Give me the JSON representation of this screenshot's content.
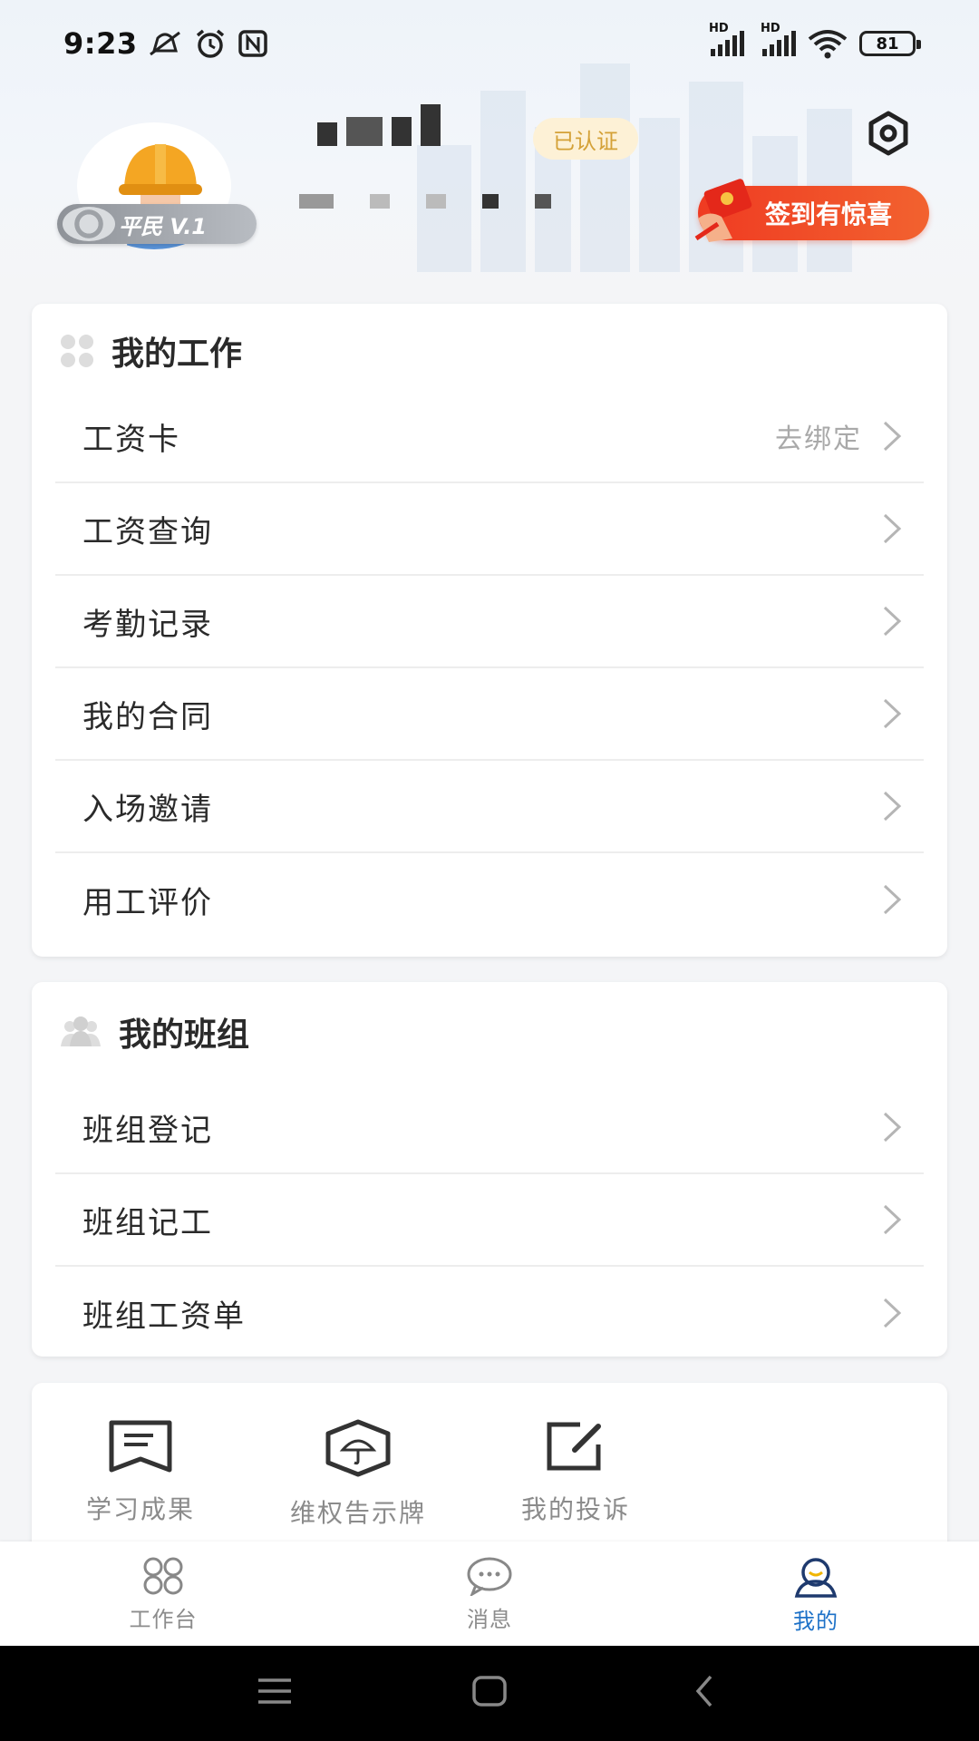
{
  "status_bar": {
    "time": "9:23",
    "battery": "81",
    "signal_label": "HD"
  },
  "profile": {
    "verified_label": "已认证",
    "level_label": "平民 V.1",
    "checkin_label": "签到有惊喜"
  },
  "work_section": {
    "title": "我的工作",
    "items": [
      {
        "label": "工资卡",
        "extra": "去绑定"
      },
      {
        "label": "工资查询"
      },
      {
        "label": "考勤记录"
      },
      {
        "label": "我的合同"
      },
      {
        "label": "入场邀请"
      },
      {
        "label": "用工评价"
      }
    ]
  },
  "team_section": {
    "title": "我的班组",
    "items": [
      {
        "label": "班组登记"
      },
      {
        "label": "班组记工"
      },
      {
        "label": "班组工资单"
      }
    ]
  },
  "quick_actions": [
    {
      "label": "学习成果",
      "icon": "book-flag-icon"
    },
    {
      "label": "维权告示牌",
      "icon": "umbrella-shield-icon"
    },
    {
      "label": "我的投诉",
      "icon": "edit-icon"
    }
  ],
  "tabbar": {
    "items": [
      {
        "label": "工作台",
        "icon": "grid-icon"
      },
      {
        "label": "消息",
        "icon": "chat-icon"
      },
      {
        "label": "我的",
        "icon": "user-icon",
        "active": true
      }
    ],
    "active_color": "#1e72c8"
  },
  "colors": {
    "checkin": "#ef3b22",
    "verified_text": "#d4a137",
    "accent": "#1e72c8"
  }
}
